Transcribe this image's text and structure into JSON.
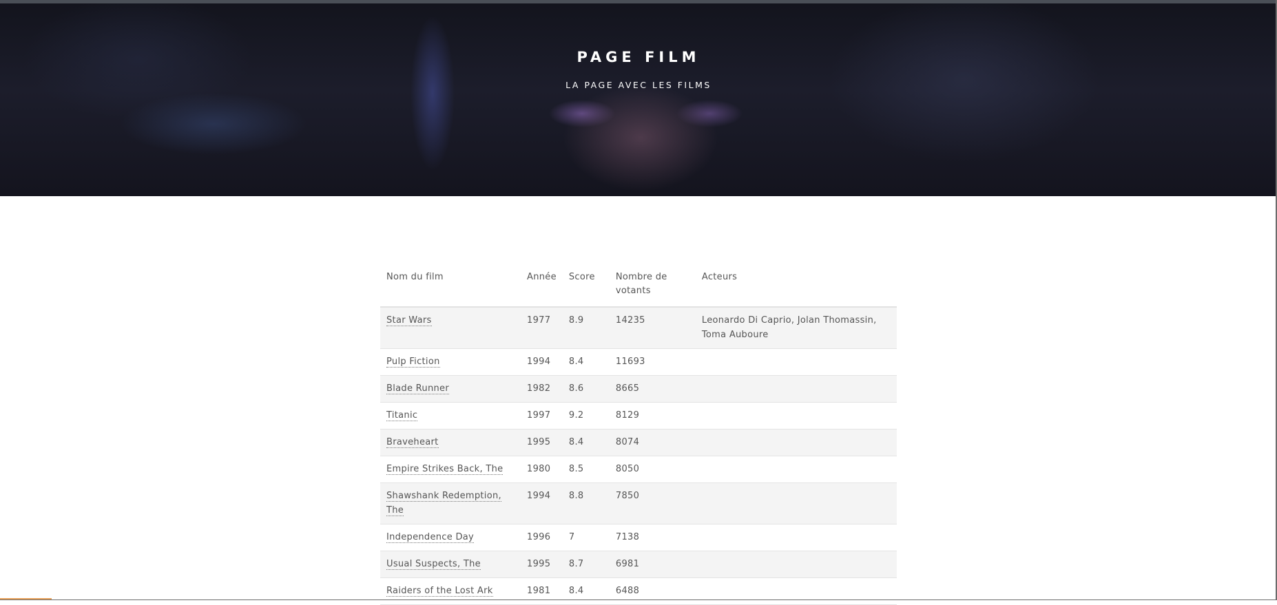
{
  "header": {
    "title": "PAGE FILM",
    "subtitle": "LA PAGE AVEC LES FILMS"
  },
  "table": {
    "columns": [
      "Nom du film",
      "Année",
      "Score",
      "Nombre de votants",
      "Acteurs"
    ],
    "rows": [
      {
        "title": "Star Wars",
        "year": "1977",
        "score": "8.9",
        "votes": "14235",
        "actors": "Leonardo Di Caprio, Jolan Thomassin, Toma Auboure"
      },
      {
        "title": "Pulp Fiction",
        "year": "1994",
        "score": "8.4",
        "votes": "11693",
        "actors": ""
      },
      {
        "title": "Blade Runner",
        "year": "1982",
        "score": "8.6",
        "votes": "8665",
        "actors": ""
      },
      {
        "title": "Titanic",
        "year": "1997",
        "score": "9.2",
        "votes": "8129",
        "actors": ""
      },
      {
        "title": "Braveheart",
        "year": "1995",
        "score": "8.4",
        "votes": "8074",
        "actors": ""
      },
      {
        "title": "Empire Strikes Back, The",
        "year": "1980",
        "score": "8.5",
        "votes": "8050",
        "actors": ""
      },
      {
        "title": "Shawshank Redemption, The",
        "year": "1994",
        "score": "8.8",
        "votes": "7850",
        "actors": ""
      },
      {
        "title": "Independence Day",
        "year": "1996",
        "score": "7",
        "votes": "7138",
        "actors": ""
      },
      {
        "title": "Usual Suspects, The",
        "year": "1995",
        "score": "8.7",
        "votes": "6981",
        "actors": ""
      },
      {
        "title": "Raiders of the Lost Ark",
        "year": "1981",
        "score": "8.4",
        "votes": "6488",
        "actors": ""
      }
    ]
  },
  "colors": {
    "hero_background": "#181926",
    "hero_text": "#ffffff",
    "body_text": "#555555",
    "row_stripe": "#f4f4f4",
    "accent": "#e8a15a"
  }
}
